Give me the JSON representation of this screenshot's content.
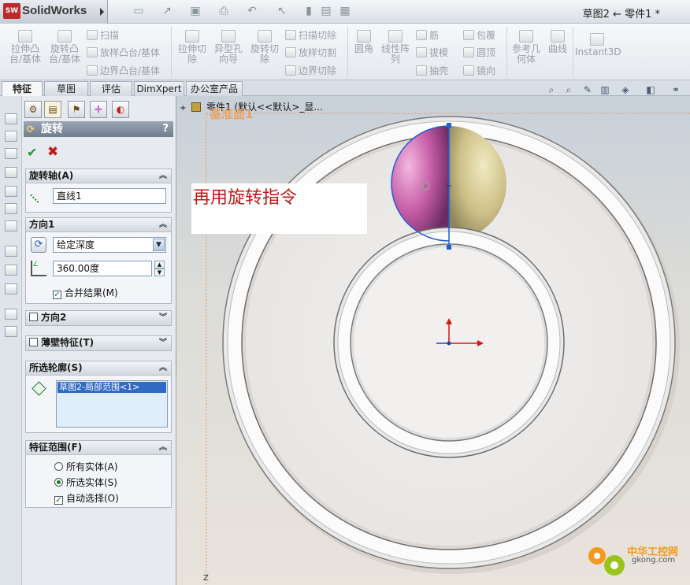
{
  "titlebar": {
    "app_name": "SolidWorks",
    "logo_text": "SW",
    "document_title": "草图2 ← 零件1 *"
  },
  "ribbon": {
    "extrude_boss": "拉伸凸\n台/基体",
    "revolve_boss": "旋转凸\n台/基体",
    "sweep": "扫描",
    "loft_boss": "放样凸台/基体",
    "boundary_boss": "边界凸台/基体",
    "extrude_cut": "拉伸切\n除",
    "hole_wizard": "异型孔\n向导",
    "revolve_cut": "旋转切\n除",
    "swept_cut": "扫描切除",
    "lofted_cut": "放样切割",
    "boundary_cut": "边界切除",
    "fillet": "圆角",
    "linear_pattern": "线性阵\n列",
    "rib": "筋",
    "draft": "拔模",
    "shell": "抽壳",
    "wrap": "包覆",
    "dome": "圆顶",
    "mirror": "镜向",
    "reference_geometry": "参考几\n何体",
    "curves": "曲线",
    "instant3d": "Instant3D"
  },
  "tabs": [
    {
      "label": "特征",
      "active": true
    },
    {
      "label": "草图",
      "active": false
    },
    {
      "label": "评估",
      "active": false
    },
    {
      "label": "DimXpert",
      "active": false
    },
    {
      "label": "办公室产品",
      "active": false
    }
  ],
  "property_manager": {
    "title": "旋转",
    "help": "?",
    "ok_symbol": "✔",
    "cancel_symbol": "✖",
    "axis_group": {
      "title": "旋转轴(A)",
      "value": "直线1"
    },
    "direction1_group": {
      "title": "方向1",
      "end_condition": "给定深度",
      "angle": "360.00度",
      "merge_result_label": "合并结果(M)",
      "merge_result_checked": true
    },
    "direction2_group": {
      "title": "方向2",
      "checked": false
    },
    "thin_feature_group": {
      "title": "薄壁特征(T)",
      "checked": false
    },
    "selected_contours_group": {
      "title": "所选轮廓(S)",
      "items": [
        "草图2-局部范围<1>"
      ]
    },
    "feature_scope_group": {
      "title": "特征范围(F)",
      "all_bodies": "所有实体(A)",
      "selected_bodies": "所选实体(S)",
      "auto_select": "自动选择(O)",
      "selected_option": "selected_bodies",
      "auto_select_checked": true
    }
  },
  "viewport": {
    "tree_root": "零件1  (默认<<默认>_显...",
    "plane_label": "基准面1",
    "annotation": "再用旋转指令",
    "z_label": "Z"
  },
  "watermark": {
    "line1": "中华工控网",
    "line2": "gkong.com"
  },
  "colors": {
    "accent_red": "#c01818",
    "ok_green": "#1e9a2a",
    "sketch_blue": "#1f5fd6",
    "ring_white": "#f7f7f7"
  },
  "icons": {
    "ok": "check-icon",
    "cancel": "close-icon",
    "revolve": "revolve-icon",
    "axis": "axis-line-icon",
    "reverse_direction": "reverse-direction-icon",
    "angle": "angle-icon",
    "profile": "profile-diamond-icon"
  }
}
